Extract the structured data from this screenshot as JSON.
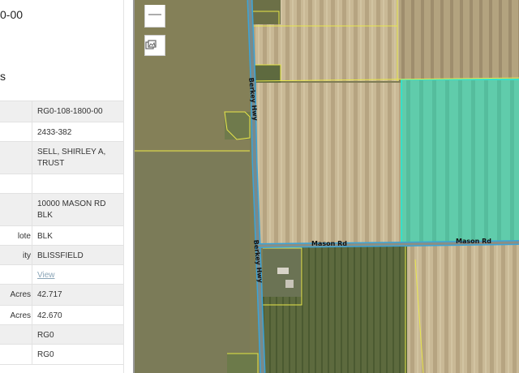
{
  "panel": {
    "title": "0-00",
    "subtitle": "s",
    "rows": [
      {
        "label": "",
        "value": "RG0-108-1800-00"
      },
      {
        "label": "",
        "value": "2433-382"
      },
      {
        "label": "",
        "value": "SELL, SHIRLEY A, TRUST"
      },
      {
        "label": "",
        "value": ""
      },
      {
        "label": "",
        "value": "10000 MASON RD BLK"
      },
      {
        "label": "lote",
        "value": "BLK"
      },
      {
        "label": "ity",
        "value": "BLISSFIELD"
      },
      {
        "label": "",
        "value": "View"
      },
      {
        "label": "Acres",
        "value": "42.717"
      },
      {
        "label": "Acres",
        "value": "42.670"
      },
      {
        "label": "",
        "value": "RG0"
      },
      {
        "label": "",
        "value": "RG0"
      }
    ]
  },
  "map": {
    "zoom_out_label": "—",
    "roads": {
      "berkey_hwy": "Berkey Hwy",
      "mason_rd": "Mason Rd"
    },
    "colors": {
      "parcel_line": "#e8e64a",
      "selected_fill": "#4fd8b8",
      "selected_border": "#37e0c8",
      "road_casing": "#3ba4d8"
    }
  }
}
